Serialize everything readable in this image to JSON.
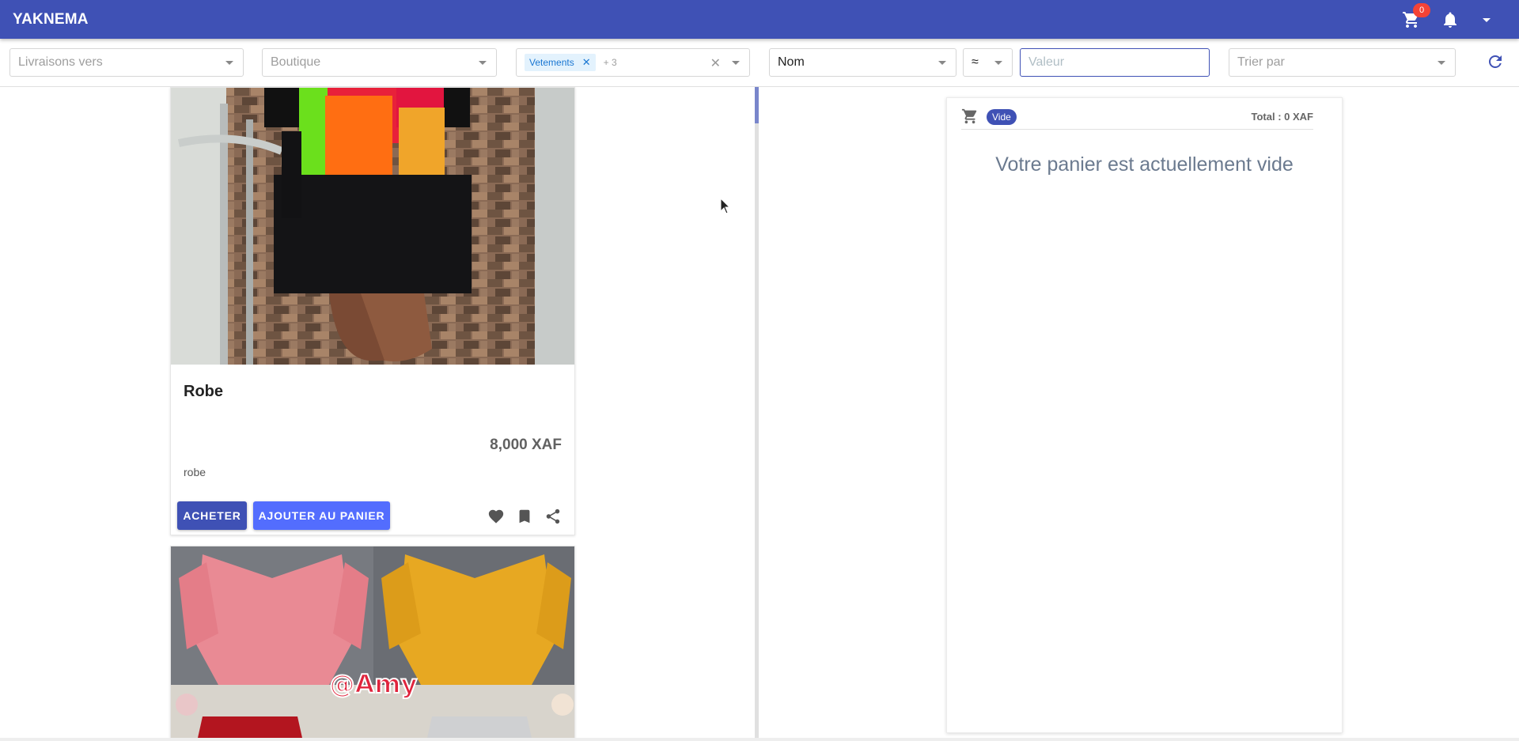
{
  "header": {
    "brand": "YAKNEMA",
    "cart_count": "0"
  },
  "filters": {
    "delivery_placeholder": "Livraisons vers",
    "shop_placeholder": "Boutique",
    "category_chip": "Vetements",
    "category_more": "+ 3",
    "field_select": "Nom",
    "operator_select": "≈",
    "value_placeholder": "Valeur",
    "sort_placeholder": "Trier par"
  },
  "products": [
    {
      "title": "Robe",
      "price": "8,000 XAF",
      "description": "robe",
      "buy_label": "ACHETER",
      "add_to_cart_label": "AJOUTER AU PANIER"
    },
    {
      "image_text": "@Amy"
    }
  ],
  "cart": {
    "status_badge": "Vide",
    "total": "Total : 0 XAF",
    "empty_message": "Votre panier est actuellement vide"
  },
  "colors": {
    "primary": "#3f51b5",
    "accent": "#536dfe",
    "badge": "#f44336"
  }
}
